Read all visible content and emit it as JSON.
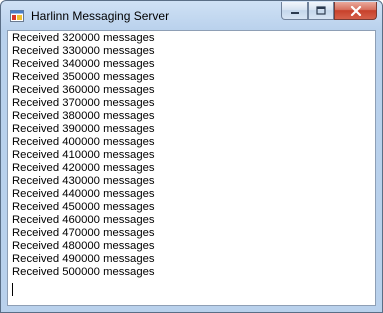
{
  "window": {
    "title": "Harlinn Messaging Server",
    "buttons": {
      "minimize_icon": "minimize-icon",
      "maximize_icon": "maximize-icon",
      "close_icon": "close-icon"
    }
  },
  "log": {
    "lines": [
      "Received 320000 messages",
      "Received 330000 messages",
      "Received 340000 messages",
      "Received 350000 messages",
      "Received 360000 messages",
      "Received 370000 messages",
      "Received 380000 messages",
      "Received 390000 messages",
      "Received 400000 messages",
      "Received 410000 messages",
      "Received 420000 messages",
      "Received 430000 messages",
      "Received 440000 messages",
      "Received 450000 messages",
      "Received 460000 messages",
      "Received 470000 messages",
      "Received 480000 messages",
      "Received 490000 messages",
      "Received 500000 messages"
    ]
  }
}
